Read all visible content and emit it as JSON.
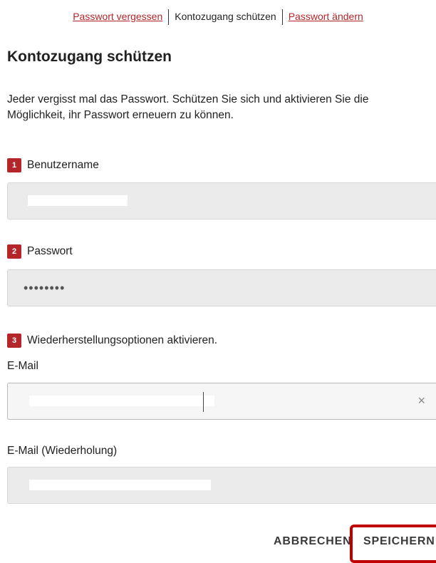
{
  "nav": {
    "forgot_password": "Passwort vergessen",
    "protect_access": "Kontozugang schützen",
    "change_password": "Passwort ändern"
  },
  "page_title": "Kontozugang schützen",
  "intro_text": "Jeder vergisst mal das Passwort. Schützen Sie sich und aktivieren Sie die Möglichkeit, ihr Passwort erneuern zu können.",
  "steps": [
    {
      "number": "1",
      "label": "Benutzername"
    },
    {
      "number": "2",
      "label": "Passwort"
    },
    {
      "number": "3",
      "label": "Wiederherstellungsoptionen aktivieren."
    }
  ],
  "password_field": {
    "value": "••••••••"
  },
  "email_field": {
    "label": "E-Mail",
    "clear_icon": "×"
  },
  "email_repeat_field": {
    "label": "E-Mail (Wiederholung)"
  },
  "buttons": {
    "cancel": "ABBRECHEN",
    "save": "SPEICHERN"
  },
  "colors": {
    "accent": "#b4262a",
    "highlight": "#c00000"
  }
}
